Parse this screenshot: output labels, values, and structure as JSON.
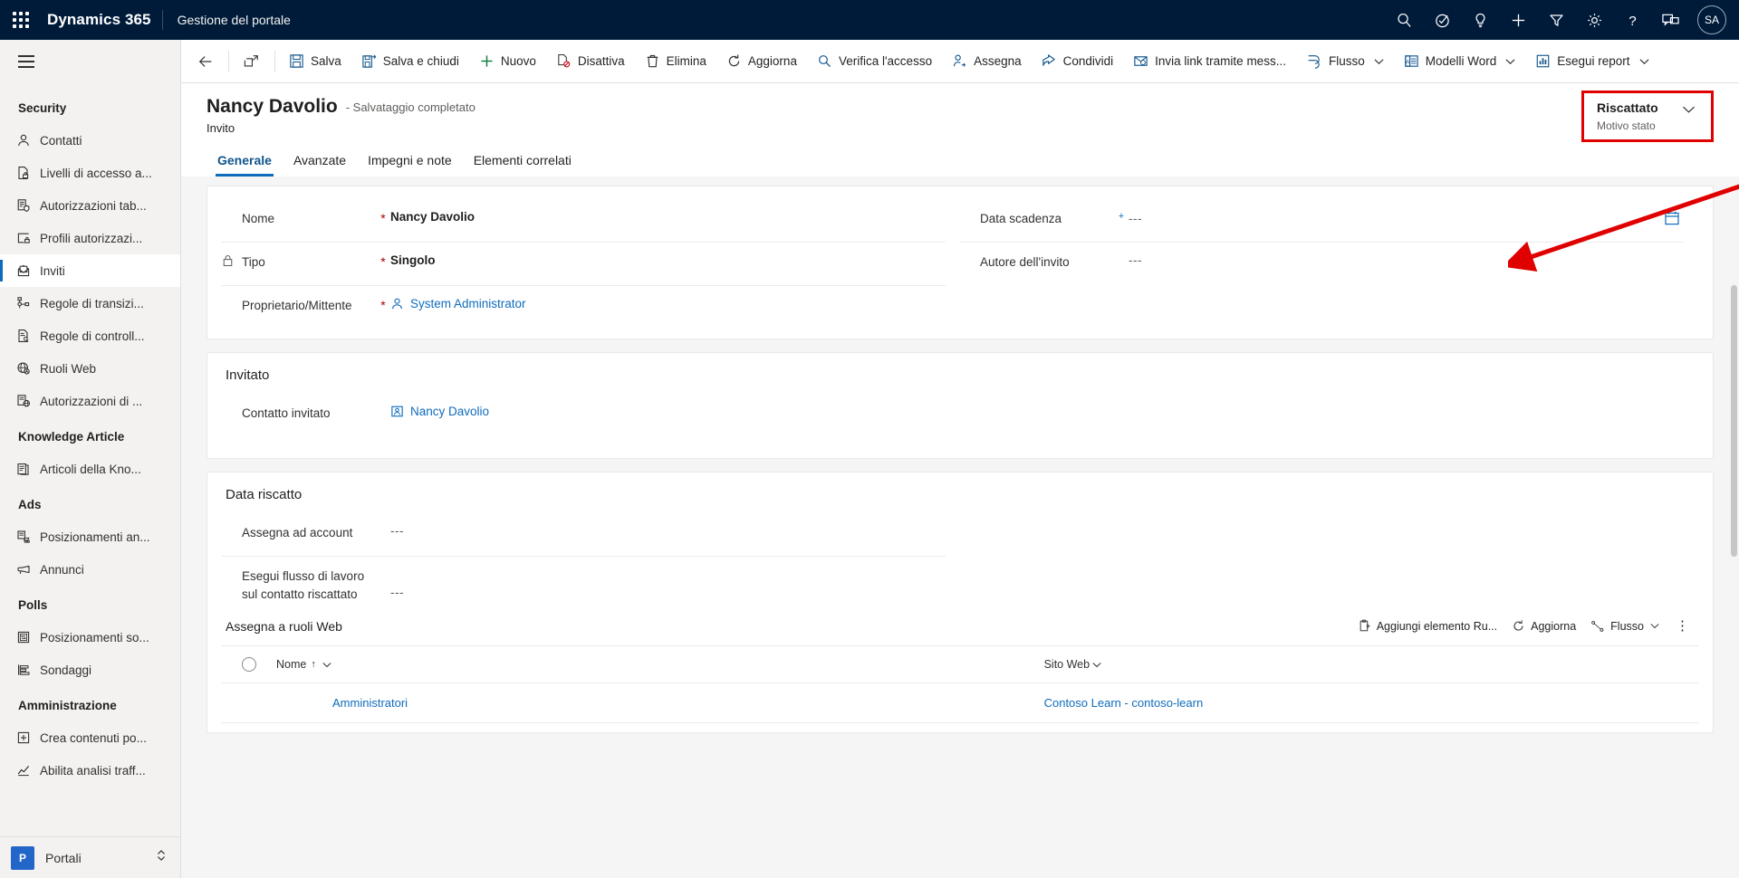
{
  "topnav": {
    "waffle_icon": "waffle-icon",
    "brand": "Dynamics 365",
    "app_name": "Gestione del portale",
    "icons": [
      {
        "name": "search-icon",
        "label": "Ricerca"
      },
      {
        "name": "assistant-icon",
        "label": "Assistente relazioni"
      },
      {
        "name": "lightbulb-icon",
        "label": "Suggerimenti"
      },
      {
        "name": "plus-icon",
        "label": "Nuovo"
      },
      {
        "name": "filter-icon",
        "label": "Filtro"
      },
      {
        "name": "gear-icon",
        "label": "Impostazioni"
      },
      {
        "name": "help-icon",
        "label": "Guida"
      },
      {
        "name": "feedback-icon",
        "label": "Feedback"
      }
    ],
    "avatar_initials": "SA"
  },
  "sidebar": {
    "hamburger_label": "Espandi il riquadro di spostamento",
    "groups": [
      {
        "title": "Security",
        "items": [
          {
            "label": "Contatti",
            "icon": "contact-icon",
            "active": false
          },
          {
            "label": "Livelli di accesso a...",
            "icon": "access-level-icon",
            "active": false
          },
          {
            "label": "Autorizzazioni tab...",
            "icon": "table-permission-icon",
            "active": false
          },
          {
            "label": "Profili autorizzazi...",
            "icon": "permission-profile-icon",
            "active": false
          },
          {
            "label": "Inviti",
            "icon": "invitation-icon",
            "active": true
          },
          {
            "label": "Regole di transizi...",
            "icon": "transition-rule-icon",
            "active": false
          },
          {
            "label": "Regole di controll...",
            "icon": "validation-rule-icon",
            "active": false
          },
          {
            "label": "Ruoli Web",
            "icon": "web-role-icon",
            "active": false
          },
          {
            "label": "Autorizzazioni di ...",
            "icon": "web-permission-icon",
            "active": false
          }
        ]
      },
      {
        "title": "Knowledge Article",
        "items": [
          {
            "label": "Articoli della Kno...",
            "icon": "article-icon",
            "active": false
          }
        ]
      },
      {
        "title": "Ads",
        "items": [
          {
            "label": "Posizionamenti an...",
            "icon": "ad-placement-icon",
            "active": false
          },
          {
            "label": "Annunci",
            "icon": "megaphone-icon",
            "active": false
          }
        ]
      },
      {
        "title": "Polls",
        "items": [
          {
            "label": "Posizionamenti so...",
            "icon": "poll-placement-icon",
            "active": false
          },
          {
            "label": "Sondaggi",
            "icon": "poll-icon",
            "active": false
          }
        ]
      },
      {
        "title": "Amministrazione",
        "items": [
          {
            "label": "Crea contenuti po...",
            "icon": "create-content-icon",
            "active": false
          },
          {
            "label": "Abilita analisi traff...",
            "icon": "analytics-icon",
            "active": false
          }
        ]
      }
    ],
    "footer": {
      "badge": "P",
      "label": "Portali",
      "caret_icon": "chevron-updown-icon"
    }
  },
  "commandbar": {
    "back_icon": "back-arrow-icon",
    "popout_icon": "open-in-new-window-icon",
    "items": [
      {
        "label": "Salva",
        "icon": "save-icon",
        "caret": false
      },
      {
        "label": "Salva e chiudi",
        "icon": "save-and-close-icon",
        "caret": false
      },
      {
        "label": "Nuovo",
        "icon": "plus-icon",
        "caret": false
      },
      {
        "label": "Disattiva",
        "icon": "deactivate-icon",
        "caret": false
      },
      {
        "label": "Elimina",
        "icon": "trash-icon",
        "caret": false
      },
      {
        "label": "Aggiorna",
        "icon": "refresh-icon",
        "caret": false
      },
      {
        "label": "Verifica l'accesso",
        "icon": "check-access-icon",
        "caret": false
      },
      {
        "label": "Assegna",
        "icon": "assign-icon",
        "caret": false
      },
      {
        "label": "Condividi",
        "icon": "share-icon",
        "caret": false
      },
      {
        "label": "Invia link tramite mess...",
        "icon": "email-link-icon",
        "caret": false
      },
      {
        "label": "Flusso",
        "icon": "flow-icon",
        "caret": true
      },
      {
        "label": "Modelli Word",
        "icon": "word-template-icon",
        "caret": true
      },
      {
        "label": "Esegui report",
        "icon": "run-report-icon",
        "caret": true
      }
    ]
  },
  "record": {
    "title": "Nancy Davolio",
    "save_state": "- Salvataggio completato",
    "entity": "Invito",
    "status": {
      "value": "Riscattato",
      "label": "Motivo stato",
      "caret_icon": "chevron-down-icon",
      "highlight_color": "#e00000"
    }
  },
  "tabs": [
    {
      "label": "Generale",
      "active": true
    },
    {
      "label": "Avanzate",
      "active": false
    },
    {
      "label": "Impegni e note",
      "active": false
    },
    {
      "label": "Elementi correlati",
      "active": false
    }
  ],
  "form": {
    "general": {
      "left_fields": [
        {
          "label": "Nome",
          "required": "*",
          "value": "Nancy Davolio",
          "kind": "text",
          "locked": false
        },
        {
          "label": "Tipo",
          "required": "*",
          "value": "Singolo",
          "kind": "text",
          "locked": true,
          "lock_icon": "lock-icon"
        },
        {
          "label": "Proprietario/Mittente",
          "required": "*",
          "value": "System Administrator",
          "kind": "link",
          "icon": "user-icon",
          "locked": false
        }
      ],
      "right_fields": [
        {
          "label": "Data scadenza",
          "required": "+",
          "value": "---",
          "kind": "dashes",
          "trailing_icon": "calendar-icon"
        },
        {
          "label": "Autore dell'invito",
          "required": "",
          "value": "---",
          "kind": "dashes",
          "trailing_icon": ""
        }
      ]
    },
    "invitato": {
      "title": "Invitato",
      "fields": [
        {
          "label": "Contatto invitato",
          "required": "",
          "value": "Nancy Davolio",
          "kind": "link",
          "icon": "contact-card-icon"
        }
      ]
    },
    "data_riscatto": {
      "title": "Data riscatto",
      "fields": [
        {
          "label": "Assegna ad account",
          "required": "",
          "value": "---",
          "kind": "dashes"
        },
        {
          "label": "Esegui flusso di lavoro sul contatto riscattato",
          "required": "",
          "value": "---",
          "kind": "dashes"
        }
      ]
    },
    "subgrid": {
      "title": "Assegna a ruoli Web",
      "commands": [
        {
          "label": "Aggiungi elemento Ru...",
          "icon": "add-existing-icon",
          "caret": false
        },
        {
          "label": "Aggiorna",
          "icon": "refresh-icon",
          "caret": false
        },
        {
          "label": "Flusso",
          "icon": "flow-icon",
          "caret": true
        }
      ],
      "more_icon": "more-vertical-icon",
      "columns": [
        {
          "label": "Nome",
          "sorted": true,
          "sort_arrow": "↑",
          "caret_icon": "chevron-down-icon"
        },
        {
          "label": "Sito Web",
          "sorted": false,
          "sort_arrow": "",
          "caret_icon": "chevron-down-icon"
        }
      ],
      "select_all_icon": "select-all-circle-icon",
      "rows": [
        {
          "name": "Amministratori",
          "website": "Contoso Learn - contoso-learn"
        }
      ]
    }
  },
  "annotation": {
    "arrow_name": "red-pointer-arrow",
    "color": "#e00000"
  }
}
